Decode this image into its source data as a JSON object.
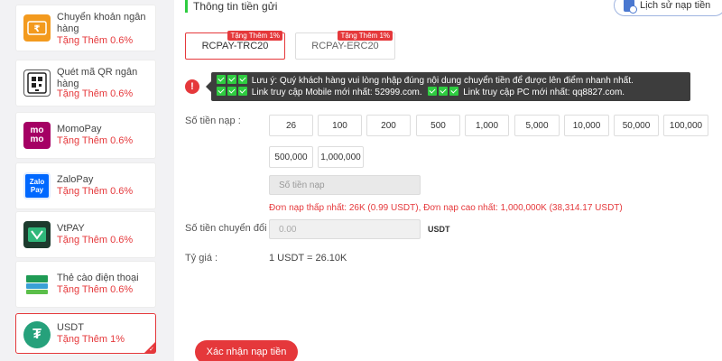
{
  "sidebar": {
    "items": [
      {
        "name": "Chuyển khoản ngân hàng",
        "bonus": "Tặng Thêm 0.6%",
        "icon": "bank-transfer-icon"
      },
      {
        "name": "Quét mã QR ngân hàng",
        "bonus": "Tặng Thêm 0.6%",
        "icon": "qr-code-icon"
      },
      {
        "name": "MomoPay",
        "bonus": "Tặng Thêm 0.6%",
        "icon": "momo-logo",
        "logo_text": "mo mo"
      },
      {
        "name": "ZaloPay",
        "bonus": "Tặng Thêm 0.6%",
        "icon": "zalopay-logo",
        "logo_text": "Zalo Pay"
      },
      {
        "name": "VtPAY",
        "bonus": "Tặng Thêm 0.6%",
        "icon": "vtpay-logo"
      },
      {
        "name": "Thẻ cào điện thoại",
        "bonus": "Tặng Thêm 0.6%",
        "icon": "phone-card-icon"
      },
      {
        "name": "USDT",
        "bonus": "Tặng Thêm 1%",
        "icon": "tether-logo",
        "logo_text": "₮"
      }
    ]
  },
  "main": {
    "title": "Thông tin tiền gửi",
    "history_label": "Lịch sử nạp tiền",
    "tabs": [
      {
        "label": "RCPAY-TRC20",
        "tag": "Tặng Thêm 1%"
      },
      {
        "label": "RCPAY-ERC20",
        "tag": "Tặng Thêm 1%"
      }
    ],
    "notice_icon": "!",
    "notice": {
      "line1": "Lưu ý: Quý khách hàng vui lòng nhập đúng nội dung chuyển tiền để được lên điểm nhanh nhất.",
      "line2a": "Link truy cập Mobile mới nhất: 52999.com.",
      "line2b": "Link truy cập PC mới nhất: qq8827.com."
    },
    "amount_label": "Số tiền nạp :",
    "amounts": [
      "26",
      "100",
      "200",
      "500",
      "1,000",
      "5,000",
      "10,000",
      "50,000",
      "100,000",
      "500,000",
      "1,000,000"
    ],
    "amount_placeholder": "Số tiền nạp",
    "min_label": "Đơn nạp thấp nhất:",
    "min_value": "26K (0.99 USDT)",
    "max_label": "Đơn nạp cao nhất:",
    "max_value": "1,000,000K (38,314.17 USDT)",
    "convert_label": "Số tiền chuyển đổi :",
    "convert_value": "0.00",
    "convert_unit": "USDT",
    "rate_label": "Tỷ giá :",
    "rate_value": "1 USDT = 26.10K",
    "submit_label": "Xác nhận nạp tiền"
  }
}
